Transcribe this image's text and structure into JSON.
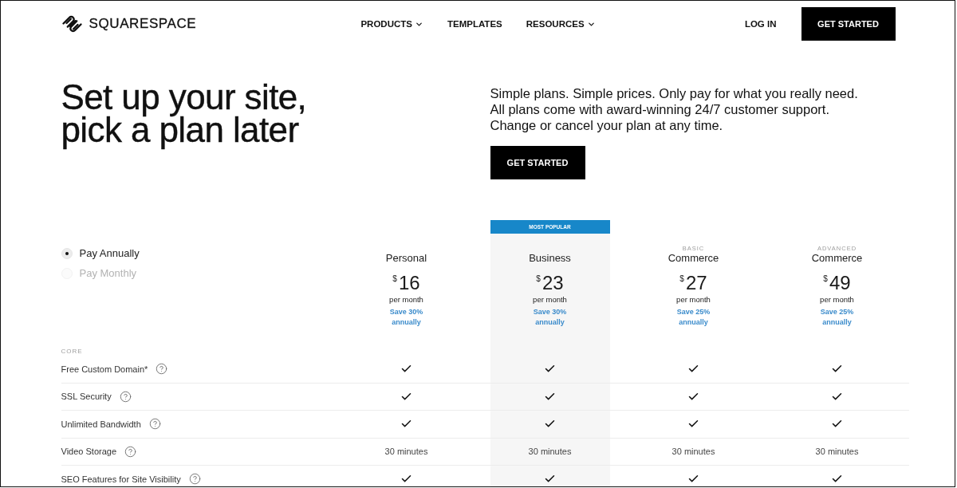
{
  "header": {
    "logo": "SQUARESPACE",
    "nav": [
      {
        "label": "PRODUCTS",
        "dropdown": true
      },
      {
        "label": "TEMPLATES",
        "dropdown": false
      },
      {
        "label": "RESOURCES",
        "dropdown": true
      }
    ],
    "login": "LOG IN",
    "cta": "GET STARTED"
  },
  "hero": {
    "headline": "Set up your site,\npick a plan later",
    "intro": "Simple plans. Simple prices. Only pay for what you really need.\nAll plans come with award-winning 24/7 customer support.\nChange or cancel your plan at any time.",
    "cta": "GET STARTED"
  },
  "billing": [
    {
      "label": "Pay Annually",
      "selected": true
    },
    {
      "label": "Pay Monthly",
      "selected": false
    }
  ],
  "plans": [
    {
      "name": "Personal",
      "currency": "$",
      "price": "16",
      "period": "per month",
      "savings": "Save 30%\nannually",
      "featured": false
    },
    {
      "badge": "MOST POPULAR",
      "name": "Business",
      "currency": "$",
      "price": "23",
      "period": "per month",
      "savings": "Save 30%\nannually",
      "featured": true
    },
    {
      "tier": "BASIC",
      "name": "Commerce",
      "currency": "$",
      "price": "27",
      "period": "per month",
      "savings": "Save 25%\nannually",
      "featured": false
    },
    {
      "tier": "ADVANCED",
      "name": "Commerce",
      "currency": "$",
      "price": "49",
      "period": "per month",
      "savings": "Save 25%\nannually",
      "featured": false
    }
  ],
  "features": {
    "section": "CORE",
    "rows": [
      {
        "label": "Free Custom Domain*",
        "cells": [
          {
            "kind": "check"
          },
          {
            "kind": "check"
          },
          {
            "kind": "check"
          },
          {
            "kind": "check"
          }
        ]
      },
      {
        "label": "SSL Security",
        "cells": [
          {
            "kind": "check"
          },
          {
            "kind": "check"
          },
          {
            "kind": "check"
          },
          {
            "kind": "check"
          }
        ]
      },
      {
        "label": "Unlimited Bandwidth",
        "cells": [
          {
            "kind": "check"
          },
          {
            "kind": "check"
          },
          {
            "kind": "check"
          },
          {
            "kind": "check"
          }
        ]
      },
      {
        "label": "Video Storage",
        "cells": [
          {
            "kind": "text",
            "text": "30 minutes"
          },
          {
            "kind": "text",
            "text": "30 minutes"
          },
          {
            "kind": "text",
            "text": "30 minutes"
          },
          {
            "kind": "text",
            "text": "30 minutes"
          }
        ]
      },
      {
        "label": "SEO Features for Site Visibility",
        "cells": [
          {
            "kind": "check"
          },
          {
            "kind": "check"
          },
          {
            "kind": "check"
          },
          {
            "kind": "check"
          }
        ]
      }
    ]
  }
}
